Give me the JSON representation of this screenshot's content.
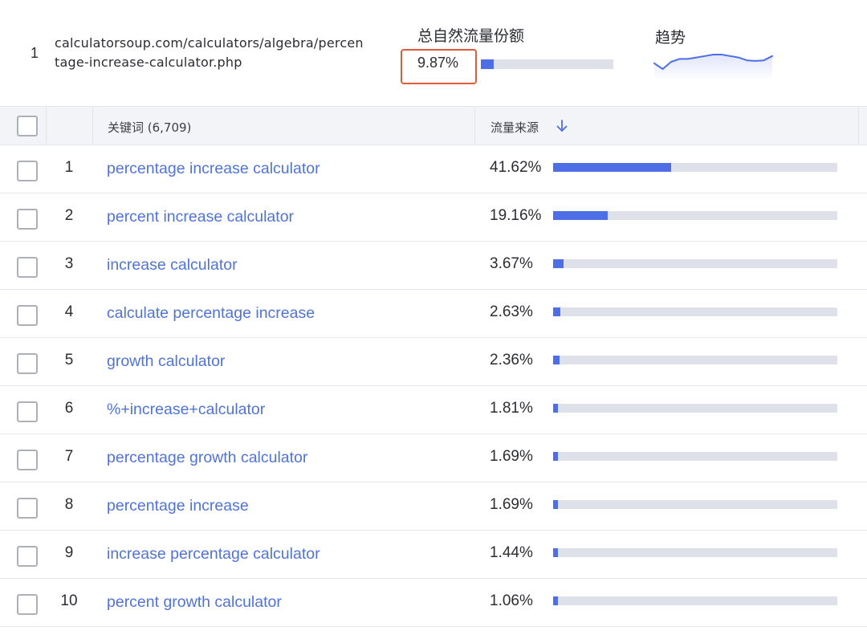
{
  "summary": {
    "rank": "1",
    "url": "calculatorsoup.com/calculators/algebra/percentage-increase-calculator.php",
    "share_label": "总自然流量份额",
    "share_value": "9.87%",
    "share_fraction": 0.0987,
    "trend_label": "趋势",
    "trend_points": [
      3,
      5,
      2.5,
      1.5,
      1.5,
      1,
      0.5,
      0,
      0,
      0.5,
      1,
      2,
      2.2,
      2,
      0.5
    ],
    "accent_color": "#4e6ee6",
    "highlight_color": "#e05a3a"
  },
  "table": {
    "header": {
      "keyword_label": "关键词 (6,709)",
      "source_label": "流量来源",
      "sort_icon": "arrow-down-icon"
    },
    "rows": [
      {
        "rank": "1",
        "keyword": "percentage increase calculator",
        "percent": "41.62%",
        "fraction": 0.4162
      },
      {
        "rank": "2",
        "keyword": "percent increase calculator",
        "percent": "19.16%",
        "fraction": 0.1916
      },
      {
        "rank": "3",
        "keyword": "increase calculator",
        "percent": "3.67%",
        "fraction": 0.0367
      },
      {
        "rank": "4",
        "keyword": "calculate percentage increase",
        "percent": "2.63%",
        "fraction": 0.0263
      },
      {
        "rank": "5",
        "keyword": "growth calculator",
        "percent": "2.36%",
        "fraction": 0.0236
      },
      {
        "rank": "6",
        "keyword": "%+increase+calculator",
        "percent": "1.81%",
        "fraction": 0.0181
      },
      {
        "rank": "7",
        "keyword": "percentage growth calculator",
        "percent": "1.69%",
        "fraction": 0.0169
      },
      {
        "rank": "8",
        "keyword": "percentage increase",
        "percent": "1.69%",
        "fraction": 0.0169
      },
      {
        "rank": "9",
        "keyword": "increase percentage calculator",
        "percent": "1.44%",
        "fraction": 0.0144
      },
      {
        "rank": "10",
        "keyword": "percent growth calculator",
        "percent": "1.06%",
        "fraction": 0.0106
      }
    ]
  }
}
